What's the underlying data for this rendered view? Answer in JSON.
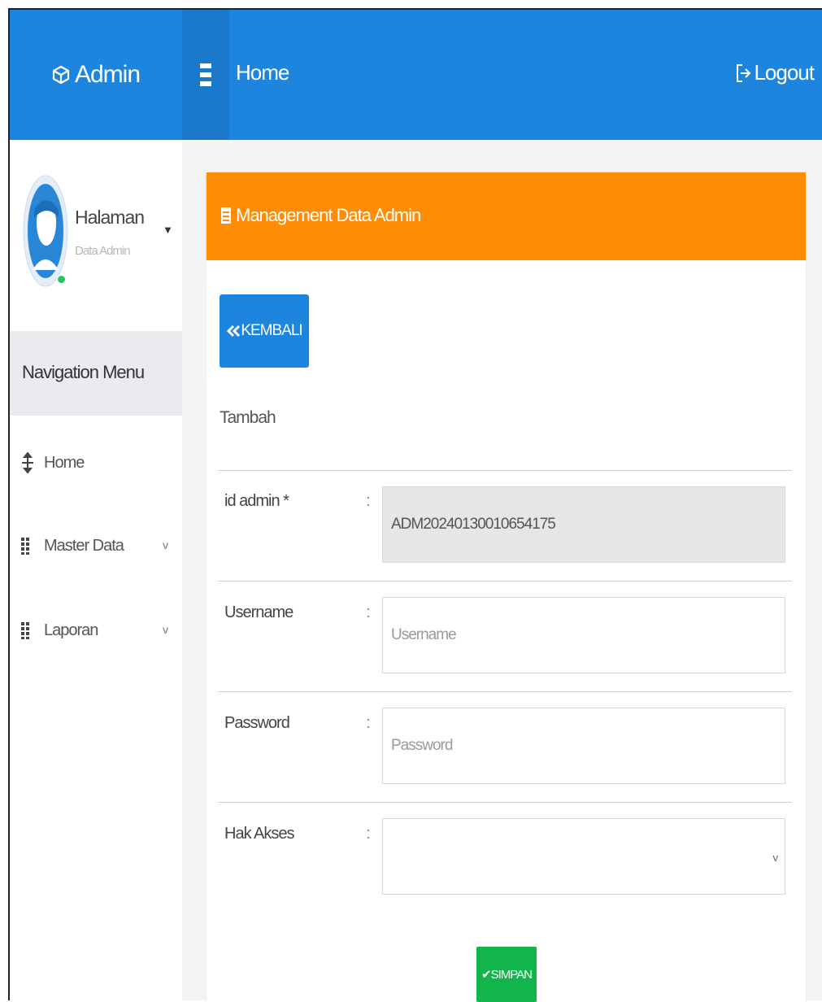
{
  "header": {
    "brand": "Admin",
    "page_title": "Home",
    "logout_label": "Logout"
  },
  "sidebar": {
    "profile_name": "Halaman",
    "profile_subtitle": "Data Admin",
    "nav_header": "Navigation Menu",
    "items": [
      {
        "label": "Home",
        "icon": "pointer-icon"
      },
      {
        "label": "Master Data",
        "icon": "grid-icon"
      },
      {
        "label": "Laporan",
        "icon": "grid-icon"
      }
    ]
  },
  "panel": {
    "title": "Management Data Admin",
    "back_label": "KEMBALI",
    "form_heading": "Tambah",
    "fields": {
      "id_admin": {
        "label": "id admin *",
        "value": "ADM20240130010654175"
      },
      "username": {
        "label": "Username",
        "placeholder": "Username"
      },
      "password": {
        "label": "Password",
        "placeholder": "Password"
      },
      "hak_akses": {
        "label": "Hak Akses",
        "value": ""
      }
    },
    "colon": ":",
    "save_label": "SIMPAN"
  },
  "colors": {
    "header": "#1e85de",
    "panel_header": "#ff8c05",
    "save": "#12b54c"
  }
}
